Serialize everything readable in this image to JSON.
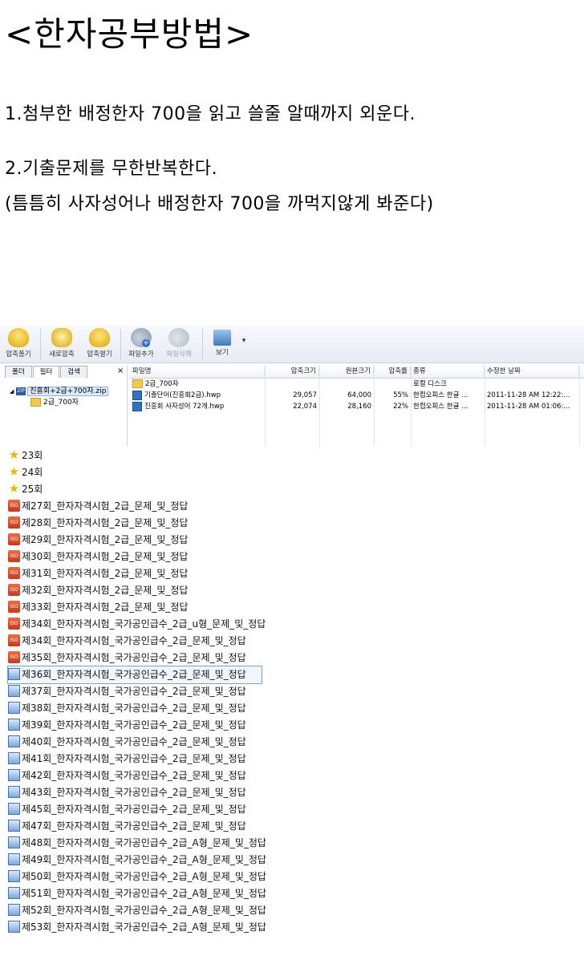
{
  "heading": "<한자공부방법>",
  "text": {
    "line1": "1.첨부한 배정한자 700을 읽고 쓸줄 알때까지 외운다.",
    "line2": "2.기출문제를 무한반복한다.",
    "line3": "(틈틈히 사자성어나 배정한자 700을 까먹지않게 봐준다)"
  },
  "toolbar": {
    "extract": "압축풀기",
    "new_archive": "새로압축",
    "open_archive": "압축열기",
    "add_file": "파일추가",
    "delete_file": "파일삭제",
    "view": "보기"
  },
  "left_pane": {
    "tabs": [
      "폴더",
      "필터",
      "검색"
    ],
    "close": "×",
    "archive": "진흥회+2급+700자.zip",
    "folder": "2급_700자"
  },
  "columns": [
    "파일명",
    "압축크기",
    "원본크기",
    "압축률",
    "종류",
    "수정한 날짜"
  ],
  "files": [
    {
      "name": "2급_700자",
      "packed": "",
      "size": "",
      "ratio": "",
      "type": "로컬 디스크",
      "date": "",
      "icon": "folder-icon"
    },
    {
      "name": "기출단어(진흥회2급).hwp",
      "packed": "29,057",
      "size": "64,000",
      "ratio": "55%",
      "type": "한컴오피스 한글 ...",
      "date": "2011-11-28 AM 12:22:...",
      "icon": "hwp-file-icon"
    },
    {
      "name": "진흥회 사자성어 72개.hwp",
      "packed": "22,074",
      "size": "28,160",
      "ratio": "22%",
      "type": "한컴오피스 한글 ...",
      "date": "2011-11-28 AM 01:06:...",
      "icon": "hwp-file-icon"
    }
  ],
  "list": [
    {
      "label": "23회",
      "icon": "star"
    },
    {
      "label": "24회",
      "icon": "star"
    },
    {
      "label": "25회",
      "icon": "star"
    },
    {
      "label": "제27회_한자자격시험_2급_문제_및_정답",
      "icon": "iso"
    },
    {
      "label": "제28회_한자자격시험_2급_문제_및_정답",
      "icon": "iso"
    },
    {
      "label": "제29회_한자자격시험_2급_문제_및_정답",
      "icon": "iso"
    },
    {
      "label": "제30회_한자자격시험_2급_문제_및_정답",
      "icon": "iso"
    },
    {
      "label": "제31회_한자자격시험_2급_문제_및_정답",
      "icon": "iso"
    },
    {
      "label": "제32회_한자자격시험_2급_문제_및_정답",
      "icon": "iso"
    },
    {
      "label": "제33회_한자자격시험_2급_문제_및_정답",
      "icon": "iso"
    },
    {
      "label": "제34회_한자자격시험_국가공인급수_2급_u형_문제_및_정답",
      "icon": "iso"
    },
    {
      "label": "제34회_한자자격시험_국가공인급수_2급_문제_및_정답",
      "icon": "iso"
    },
    {
      "label": "제35회_한자자격시험_국가공인급수_2급_문제_및_정답",
      "icon": "iso"
    },
    {
      "label": "제36회_한자자격시험_국가공인급수_2급_문제_및_정답",
      "icon": "hwp",
      "selected": true
    },
    {
      "label": "제37회_한자자격시험_국가공인급수_2급_문제_및_정답",
      "icon": "hwp"
    },
    {
      "label": "제38회_한자자격시험_국가공인급수_2급_문제_및_정답",
      "icon": "hwp"
    },
    {
      "label": "제39회_한자자격시험_국가공인급수_2급_문제_및_정답",
      "icon": "hwp"
    },
    {
      "label": "제40회_한자자격시험_국가공인급수_2급_문제_및_정답",
      "icon": "hwp"
    },
    {
      "label": "제41회_한자자격시험_국가공인급수_2급_문제_및_정답",
      "icon": "hwp"
    },
    {
      "label": "제42회_한자자격시험_국가공인급수_2급_문제_및_정답",
      "icon": "hwp"
    },
    {
      "label": "제43회_한자자격시험_국가공인급수_2급_문제_및_정답",
      "icon": "hwp"
    },
    {
      "label": "제45회_한자자격시험_국가공인급수_2급_문제_및_정답",
      "icon": "hwp"
    },
    {
      "label": "제47회_한자자격시험_국가공인급수_2급_문제_및_정답",
      "icon": "hwp"
    },
    {
      "label": "제48회_한자자격시험_국가공인급수_2급_A형_문제_및_정답",
      "icon": "hwp"
    },
    {
      "label": "제49회_한자자격시험_국가공인급수_2급_A형_문제_및_정답",
      "icon": "hwp"
    },
    {
      "label": "제50회_한자자격시험_국가공인급수_2급_A형_문제_및_정답",
      "icon": "hwp"
    },
    {
      "label": "제51회_한자자격시험_국가공인급수_2급_A형_문제_및_정답",
      "icon": "hwp"
    },
    {
      "label": "제52회_한자자격시험_국가공인급수_2급_A형_문제_및_정답",
      "icon": "hwp"
    },
    {
      "label": "제53회_한자자격시험_국가공인급수_2급_A형_문제_및_정답",
      "icon": "hwp"
    }
  ]
}
